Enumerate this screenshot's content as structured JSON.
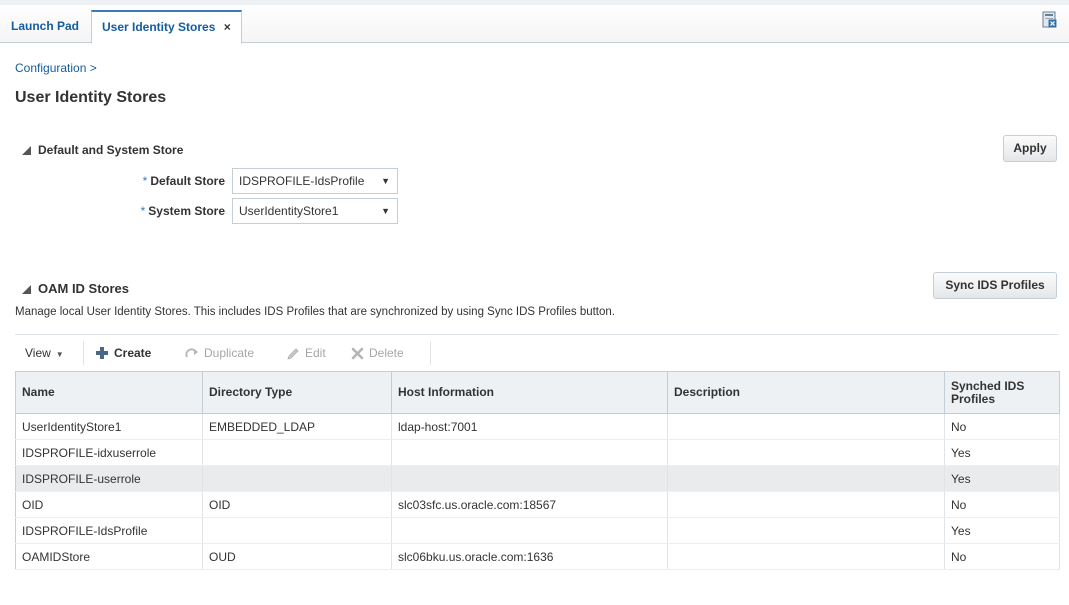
{
  "tabs": [
    {
      "label": "Launch Pad"
    },
    {
      "label": "User Identity Stores",
      "close": "×"
    }
  ],
  "breadcrumb": "Configuration >",
  "page_title": "User Identity Stores",
  "default_section": {
    "title": "Default and System Store",
    "apply_label": "Apply",
    "default_store": {
      "required": "*",
      "label": "Default Store",
      "value": "IDSPROFILE-IdsProfile",
      "arrow": "▼"
    },
    "system_store": {
      "required": "*",
      "label": "System Store",
      "value": "UserIdentityStore1",
      "arrow": "▼"
    }
  },
  "oam_section": {
    "title": "OAM ID Stores",
    "sync_label": "Sync IDS Profiles",
    "help_text": "Manage local User Identity Stores. This includes IDS Profiles that are synchronized by using Sync IDS Profiles button."
  },
  "toolbar": {
    "view": "View",
    "create": "Create",
    "duplicate": "Duplicate",
    "edit": "Edit",
    "delete": "Delete"
  },
  "table": {
    "columns": [
      "Name",
      "Directory Type",
      "Host Information",
      "Description",
      "Synched IDS Profiles"
    ],
    "rows": [
      [
        "UserIdentityStore1",
        "EMBEDDED_LDAP",
        "ldap-host:7001",
        "",
        "No"
      ],
      [
        "IDSPROFILE-idxuserrole",
        "",
        "",
        "",
        "Yes"
      ],
      [
        "IDSPROFILE-userrole",
        "",
        "",
        "",
        "Yes"
      ],
      [
        "OID",
        "OID",
        "slc03sfc.us.oracle.com:18567",
        "",
        "No"
      ],
      [
        "IDSPROFILE-IdsProfile",
        "",
        "",
        "",
        "Yes"
      ],
      [
        "OAMIDStore",
        "OUD",
        "slc06bku.us.oracle.com:1636",
        "",
        "No"
      ]
    ],
    "selected_row": 2
  },
  "colors": {
    "link": "#145c9e",
    "tab_active_border": "#3d7ab8",
    "header_bg": "#eef1f4",
    "selected_row_bg": "#e9ebed",
    "disabled_text": "#a6a6a6"
  },
  "icons": {
    "help": "help-page-icon",
    "create": "plus-icon",
    "duplicate": "duplicate-icon",
    "edit": "pencil-icon",
    "delete": "delete-x-icon"
  }
}
